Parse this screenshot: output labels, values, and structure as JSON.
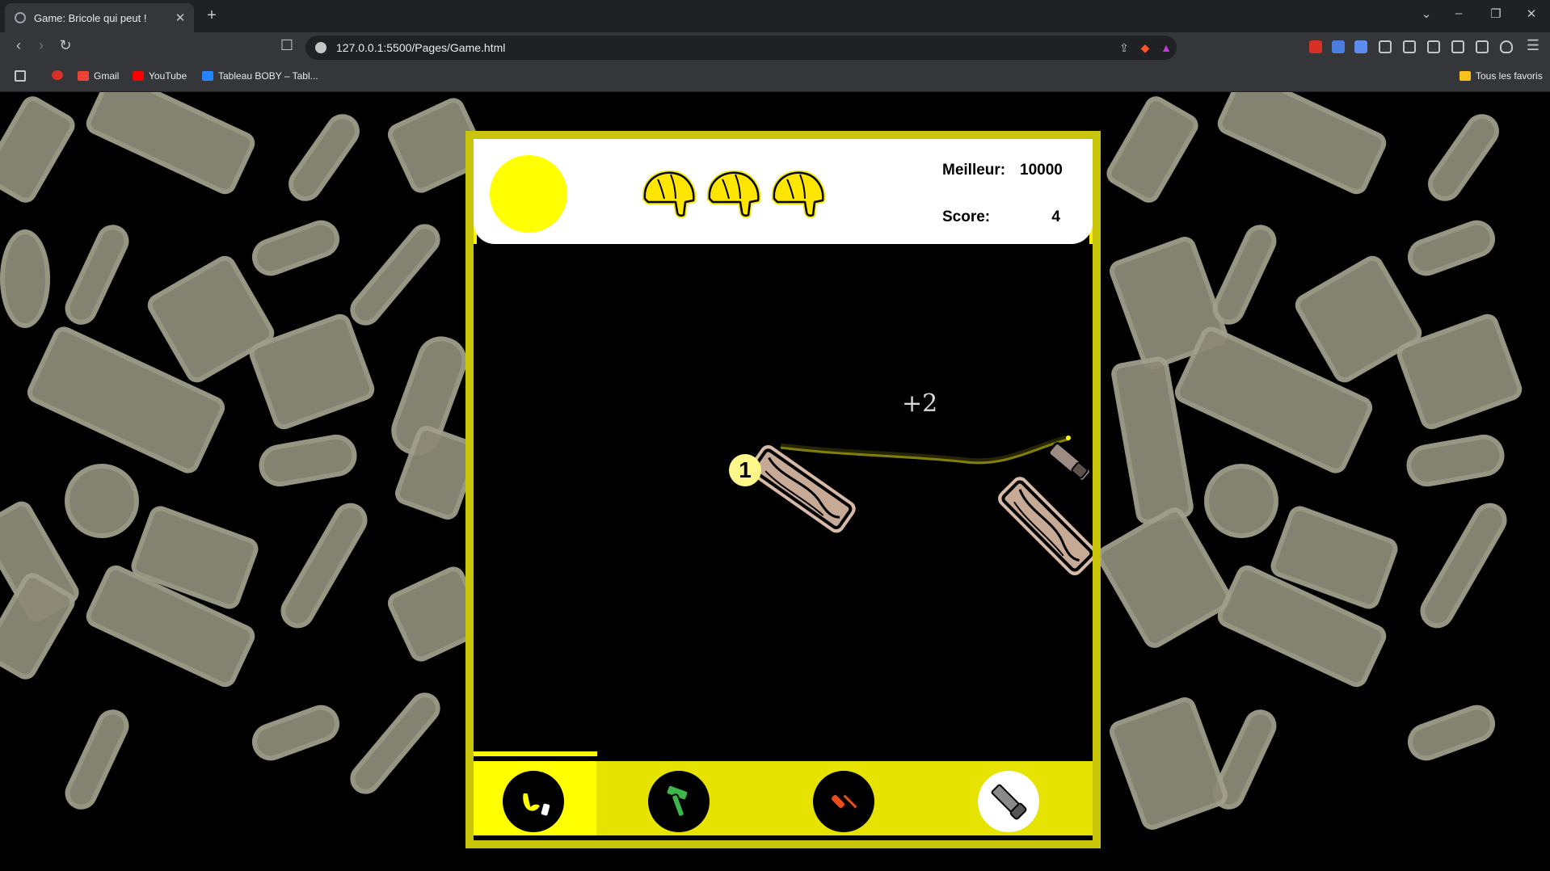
{
  "browser": {
    "tab_title": "Game: Bricole qui peut !",
    "url": "127.0.0.1:5500/Pages/Game.html",
    "bookmarks": [
      "Gmail",
      "YouTube",
      "Tableau BOBY – Tabl..."
    ],
    "all_bookmarks_label": "Tous les favoris"
  },
  "game": {
    "best_label": "Meilleur:",
    "best_value": "10000",
    "score_label": "Score:",
    "score_value": "4",
    "lives": 3,
    "floating_points": "+2",
    "combo_count": "1",
    "tools": [
      {
        "name": "arm",
        "selected": false
      },
      {
        "name": "hammer",
        "selected": false
      },
      {
        "name": "screwdriver",
        "selected": false
      },
      {
        "name": "saw",
        "selected": true
      }
    ],
    "timer_progress": 0.2
  },
  "colors": {
    "accent_yellow": "#ffff00",
    "frame_olive": "#c8c40a",
    "tools_bar": "#e6e300"
  }
}
